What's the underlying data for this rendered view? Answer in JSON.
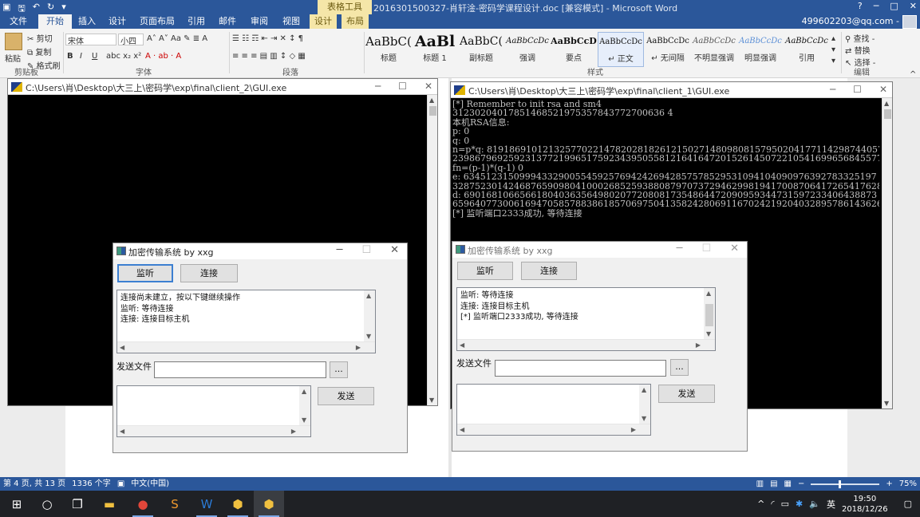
{
  "word": {
    "qat_icons": [
      "word-icon",
      "save-icon",
      "undo-icon",
      "redo-icon",
      "customize-icon"
    ],
    "title": "2016301500327-肖轩淦-密码学课程设计.doc [兼容模式] - Microsoft Word",
    "context_group": "表格工具",
    "window_controls": [
      "?",
      "─",
      "□",
      "✕"
    ],
    "tabs": [
      "文件",
      "开始",
      "插入",
      "设计",
      "页面布局",
      "引用",
      "邮件",
      "审阅",
      "视图",
      "设计",
      "布局"
    ],
    "account": "499602203@qq.com -",
    "clipboard": {
      "paste": "粘贴",
      "cut": "剪切",
      "copy": "复制",
      "format": "格式刷",
      "group": "剪贴板"
    },
    "font": {
      "name": "宋体",
      "size": "小四",
      "group": "字体"
    },
    "paragraph_group": "段落",
    "styles_group": "样式",
    "editing": {
      "find": "查找 -",
      "replace": "替换",
      "select": "选择 -",
      "group": "编辑"
    },
    "styles": [
      {
        "sample": "AaBbC(",
        "name": "标题"
      },
      {
        "sample": "AaBl",
        "name": "标题 1"
      },
      {
        "sample": "AaBbC(",
        "name": "副标题"
      },
      {
        "sample": "AaBbCcDc",
        "name": "强调"
      },
      {
        "sample": "AaBbCcD",
        "name": "要点"
      },
      {
        "sample": "AaBbCcDc",
        "name": "↵ 正文"
      },
      {
        "sample": "AaBbCcDc",
        "name": "↵ 无间隔"
      },
      {
        "sample": "AaBbCcDc",
        "name": "不明显强调"
      },
      {
        "sample": "AaBbCcDc",
        "name": "明显强调"
      },
      {
        "sample": "AaBbCcDc",
        "name": "引用"
      }
    ]
  },
  "console_left": {
    "title": "C:\\Users\\肖\\Desktop\\大三上\\密码学\\exp\\final\\client_2\\GUI.exe",
    "lines": []
  },
  "console_right": {
    "title": "C:\\Users\\肖\\Desktop\\大三上\\密码学\\exp\\final\\client_1\\GUI.exe",
    "lines": [
      "[*]      Remember to init rsa and sm4",
      "31230204017851468521975357843772700636 4",
      "本机RSA信息:",
      "p:      0",
      "q:      0",
      "n=p*q:  81918691012132577022147820281826121502714809808157950204177114298744057094 8",
      "23986796925923137721996517592343950558121641647201526145072210541699656845577 01",
      "fn=(p-1)*(q-1)  0",
      "e:      63451231509994332900554592576942426942857578529531094104090976392783325197 1",
      "32875230142468765909804100026852593880879707372946299819417008706417265417628 41",
      "d:      69016810665661804036356498020772080817354864472090959344731597233406438873",
      "65964077300616947058578838618570697504135824280691167024219204032895786143626 9",
      "[*] 监听端口2333成功, 等待连接"
    ]
  },
  "dialog_left": {
    "title": "加密传输系统 by xxg",
    "listen_label": "监听",
    "connect_label": "连接",
    "log": [
      "连接尚未建立，按以下键继续操作",
      "监听: 等待连接",
      "连接: 连接目标主机"
    ],
    "send_file_label": "发送文件",
    "browse_label": "...",
    "send_label": "发送"
  },
  "dialog_right": {
    "title": "加密传输系统 by xxg",
    "listen_label": "监听",
    "connect_label": "连接",
    "log": [
      "监听: 等待连接",
      "连接: 连接目标主机",
      "[*] 监听端口2333成功, 等待连接"
    ],
    "send_file_label": "发送文件",
    "browse_label": "...",
    "send_label": "发送"
  },
  "statusbar": {
    "page": "第 4 页, 共 13 页",
    "words": "1336 个字",
    "language": "中文(中国)",
    "zoom": "75%",
    "zoom_fraction": 0.42
  },
  "taskbar": {
    "ime": "英",
    "time": "19:50",
    "date": "2018/12/26"
  }
}
